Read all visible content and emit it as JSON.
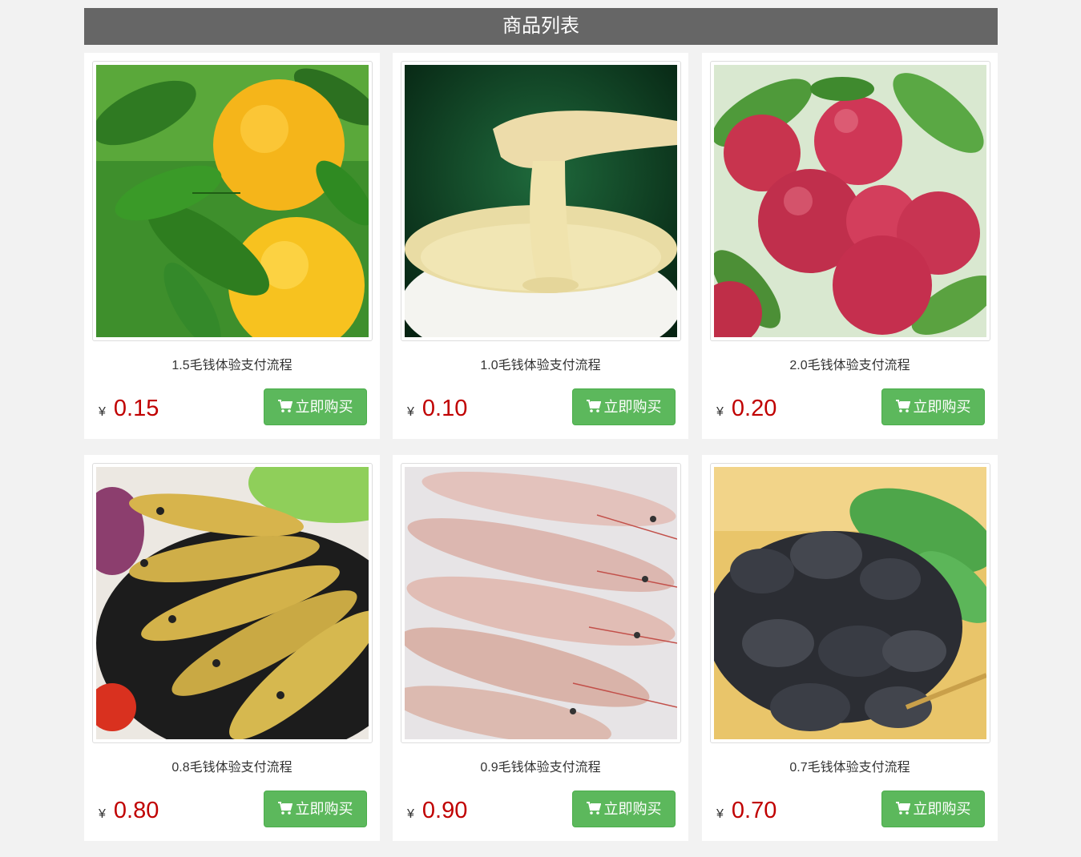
{
  "header": {
    "title": "商品列表"
  },
  "currency_symbol": "¥",
  "buy_label": "立即购买",
  "colors": {
    "accent": "#5cb85c",
    "price": "#c00000",
    "header": "#666666"
  },
  "products": [
    {
      "name": "1.5毛钱体验支付流程",
      "price": "0.15",
      "image": "orange-image"
    },
    {
      "name": "1.0毛钱体验支付流程",
      "price": "0.10",
      "image": "custard-image"
    },
    {
      "name": "2.0毛钱体验支付流程",
      "price": "0.20",
      "image": "apple-image"
    },
    {
      "name": "0.8毛钱体验支付流程",
      "price": "0.80",
      "image": "yellow-croaker-image"
    },
    {
      "name": "0.9毛钱体验支付流程",
      "price": "0.90",
      "image": "shrimp-image"
    },
    {
      "name": "0.7毛钱体验支付流程",
      "price": "0.70",
      "image": "black-fungus-image"
    }
  ]
}
